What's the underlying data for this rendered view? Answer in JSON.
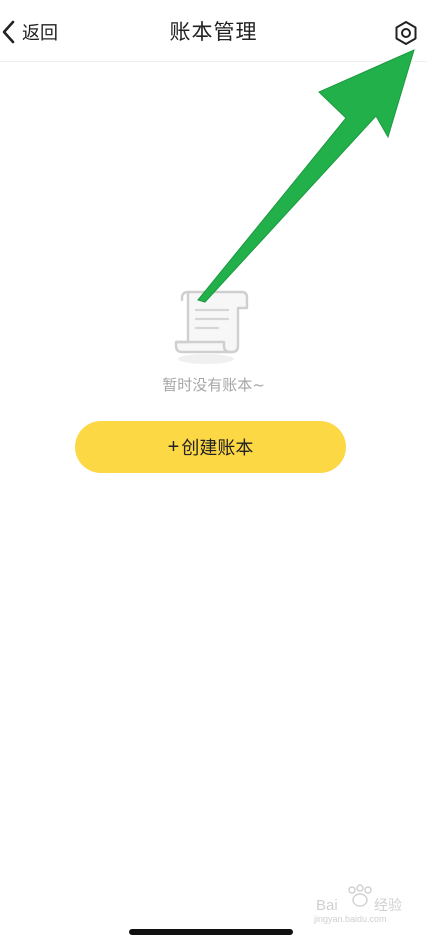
{
  "header": {
    "back_label": "返回",
    "title": "账本管理",
    "back_icon": "chevron-left-icon",
    "settings_icon": "hexagon-gear-icon"
  },
  "empty_state": {
    "icon": "receipt-scroll-icon",
    "message": "暂时没有账本~"
  },
  "create_button": {
    "plus": "+",
    "label": "创建账本"
  },
  "annotation": {
    "arrow_color": "#22b04b",
    "arrow_icon": "green-arrow-icon"
  },
  "watermark": {
    "brand": "Bai 经验",
    "url": "jingyan.baidu.com"
  },
  "colors": {
    "accent": "#fdd845",
    "muted_text": "#a6a6a6"
  }
}
